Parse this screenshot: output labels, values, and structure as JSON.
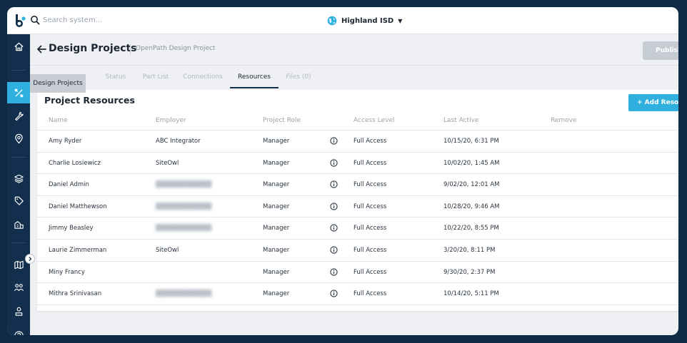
{
  "search": {
    "placeholder": "Search system..."
  },
  "org": {
    "name": "Highland ISD"
  },
  "header": {
    "title": "Design Projects",
    "subtitle": "OpenPath Design Project",
    "publish_label": "Publish Pr"
  },
  "tooltip": {
    "text": "Design Projects"
  },
  "tabs": [
    {
      "label": "",
      "active": false
    },
    {
      "label": "Status",
      "active": false
    },
    {
      "label": "Part List",
      "active": false
    },
    {
      "label": "Connections",
      "active": false
    },
    {
      "label": "Resources",
      "active": true
    },
    {
      "label": "Files (0)",
      "active": false
    }
  ],
  "card": {
    "title": "Project Resources",
    "add_label": "+ Add Resou",
    "columns": [
      "Name",
      "Employer",
      "Project Role",
      "Access Level",
      "Last Active",
      "Remove"
    ]
  },
  "rows": [
    {
      "name": "Amy Ryder",
      "employer": "ABC Integrator",
      "employer_blurred": false,
      "role": "Manager",
      "access": "Full Access",
      "last_active": "10/15/20, 6:31 PM"
    },
    {
      "name": "Charlie Losiewicz",
      "employer": "SiteOwl",
      "employer_blurred": false,
      "role": "Manager",
      "access": "Full Access",
      "last_active": "10/02/20, 1:45 AM"
    },
    {
      "name": "Daniel Admin",
      "employer": "",
      "employer_blurred": true,
      "role": "Manager",
      "access": "Full Access",
      "last_active": "9/02/20, 12:01 AM"
    },
    {
      "name": "Daniel Matthewson",
      "employer": "",
      "employer_blurred": true,
      "role": "Manager",
      "access": "Full Access",
      "last_active": "10/28/20, 9:46 AM"
    },
    {
      "name": "Jimmy Beasley",
      "employer": "",
      "employer_blurred": true,
      "role": "Manager",
      "access": "Full Access",
      "last_active": "10/22/20, 8:55 PM"
    },
    {
      "name": "Laurie Zimmerman",
      "employer": "SiteOwl",
      "employer_blurred": false,
      "role": "Manager",
      "access": "Full Access",
      "last_active": "3/20/20, 8:11 PM"
    },
    {
      "name": "Miny Francy",
      "employer": "",
      "employer_blurred": false,
      "role": "Manager",
      "access": "Full Access",
      "last_active": "9/30/20, 2:37 PM"
    },
    {
      "name": "Mithra Srinivasan",
      "employer": "",
      "employer_blurred": true,
      "role": "Manager",
      "access": "Full Access",
      "last_active": "10/14/20, 5:11 PM"
    }
  ],
  "sidebar": {
    "items": [
      {
        "icon": "home-icon",
        "active": false
      },
      {
        "icon": "design-tools-icon",
        "active": true
      },
      {
        "icon": "wrench-icon",
        "active": false
      },
      {
        "icon": "map-pin-icon",
        "active": false
      },
      {
        "icon": "layers-icon",
        "active": false
      },
      {
        "icon": "tag-icon",
        "active": false
      },
      {
        "icon": "buildings-icon",
        "active": false
      },
      {
        "icon": "map-icon",
        "active": false
      },
      {
        "icon": "people-icon",
        "active": false
      },
      {
        "icon": "user-badge-icon",
        "active": false
      },
      {
        "icon": "help-icon",
        "active": false
      }
    ]
  },
  "colors": {
    "navy": "#12304d",
    "accent": "#2fb0de",
    "publish_disabled": "#c6ccd3",
    "background": "#eef0f3"
  }
}
